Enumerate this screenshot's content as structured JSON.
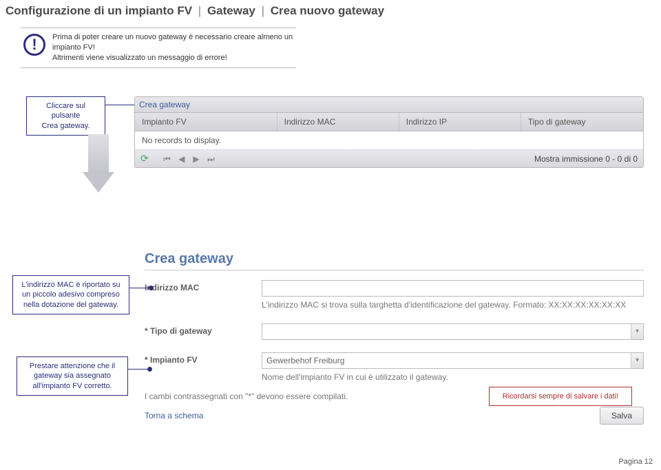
{
  "breadcrumb": {
    "p1": "Configurazione di un impianto FV",
    "p2": "Gateway",
    "p3": "Crea nuovo gateway"
  },
  "infoBlock": {
    "text": "Prima di poter creare un nuovo gateway è necessario creare almeno un impianto FV!\nAltrimenti viene visualizzato un messaggio di errore!"
  },
  "callouts": {
    "clickCreate": "Cliccare sul pulsante\nCrea gateway.",
    "macSticker": "L'indirizzo MAC è riportato su un piccolo adesivo compreso nella dotazione del gateway.",
    "assignFV": "Prestare attenzione che il gateway sia assegnato all'impianto FV corretto.",
    "rememberSave": "Ricordarsi sempre di salvare i dati!"
  },
  "grid": {
    "createLabel": "Crea gateway",
    "cols": {
      "c1": "Impianto FV",
      "c2": "Indirizzo MAC",
      "c3": "Indirizzo IP",
      "c4": "Tipo di gateway"
    },
    "empty": "No records to display.",
    "footerStatus": "Mostra immissione 0 - 0 di 0"
  },
  "form": {
    "title": "Crea gateway",
    "fields": {
      "mac": {
        "label": "Indirizzo MAC",
        "value": "",
        "hint": "L'indirizzo MAC si trova sulla targhetta d'identificazione del gateway. Formato: XX:XX:XX:XX:XX:XX"
      },
      "type": {
        "label": "* Tipo di gateway",
        "value": ""
      },
      "plant": {
        "label": "* Impianto FV",
        "value": "Gewerbehof Freiburg",
        "hint": "Nome dell'impianto FV in cui è utilizzato il gateway."
      }
    },
    "requiredNote": "I cambi contrassegnati con \"*\" devono essere compilati.",
    "backLink": "Torna a schema",
    "saveBtn": "Salva"
  },
  "footer": {
    "pageLabel": "Pagina 12"
  }
}
